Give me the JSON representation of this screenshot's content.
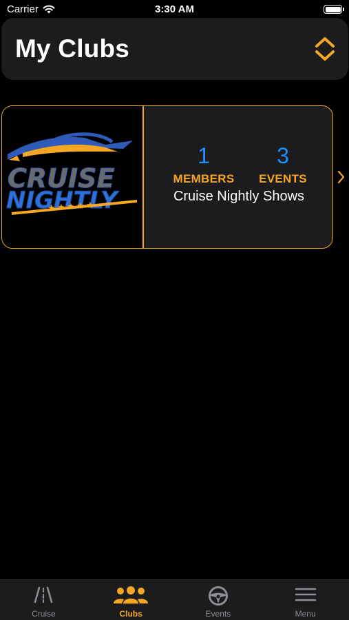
{
  "status_bar": {
    "carrier": "Carrier",
    "time": "3:30 AM"
  },
  "header": {
    "title": "My Clubs",
    "sort_icon": "sort-up-down-icon"
  },
  "clubs": [
    {
      "name": "Cruise Nightly Shows",
      "logo_text_line1": "CRUISE",
      "logo_text_line2": "NIGHTLY",
      "members_count": "1",
      "members_label": "MEMBERS",
      "events_count": "3",
      "events_label": "EVENTS"
    }
  ],
  "tab_bar": {
    "tabs": [
      {
        "label": "Cruise",
        "icon": "road-icon",
        "active": false
      },
      {
        "label": "Clubs",
        "icon": "group-icon",
        "active": true
      },
      {
        "label": "Events",
        "icon": "steering-wheel-icon",
        "active": false
      },
      {
        "label": "Menu",
        "icon": "hamburger-menu-icon",
        "active": false
      }
    ]
  },
  "colors": {
    "accent": "#f5a623",
    "stat_value": "#1e90ff",
    "background": "#000000",
    "surface": "#1c1c1e",
    "inactive": "#8e8e93"
  }
}
